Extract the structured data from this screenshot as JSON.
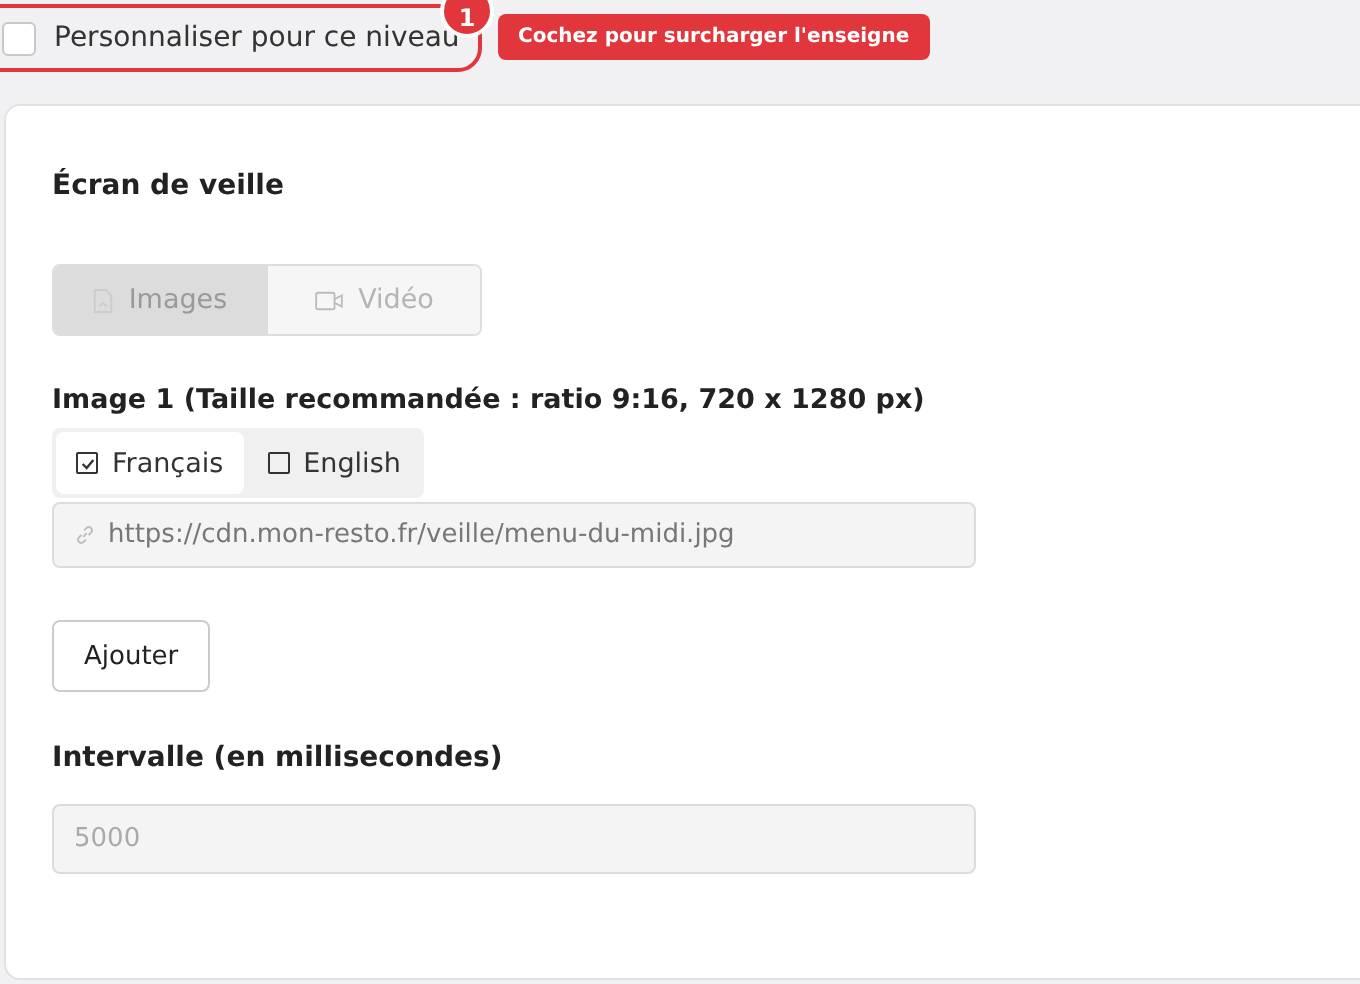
{
  "override": {
    "label": "Personnaliser pour ce niveau",
    "checked": false,
    "step": "1",
    "tooltip": "Cochez pour surcharger l'enseigne"
  },
  "card": {
    "title": "Écran de veille",
    "media_tabs": [
      {
        "label": "Images",
        "kind": "image",
        "selected": true
      },
      {
        "label": "Vidéo",
        "kind": "video",
        "selected": false
      }
    ],
    "image_label": "Image 1 (Taille recommandée : ratio 9:16, 720 x 1280 px)",
    "languages": [
      {
        "label": "Français",
        "checked": true,
        "selected": true
      },
      {
        "label": "English",
        "checked": false,
        "selected": false
      }
    ],
    "url_field": {
      "value": "https://cdn.mon-resto.fr/veille/menu-du-midi.jpg",
      "disabled": true
    },
    "add_button": "Ajouter",
    "interval_label": "Intervalle (en millisecondes)",
    "interval_field": {
      "value": "5000",
      "disabled": true
    }
  }
}
